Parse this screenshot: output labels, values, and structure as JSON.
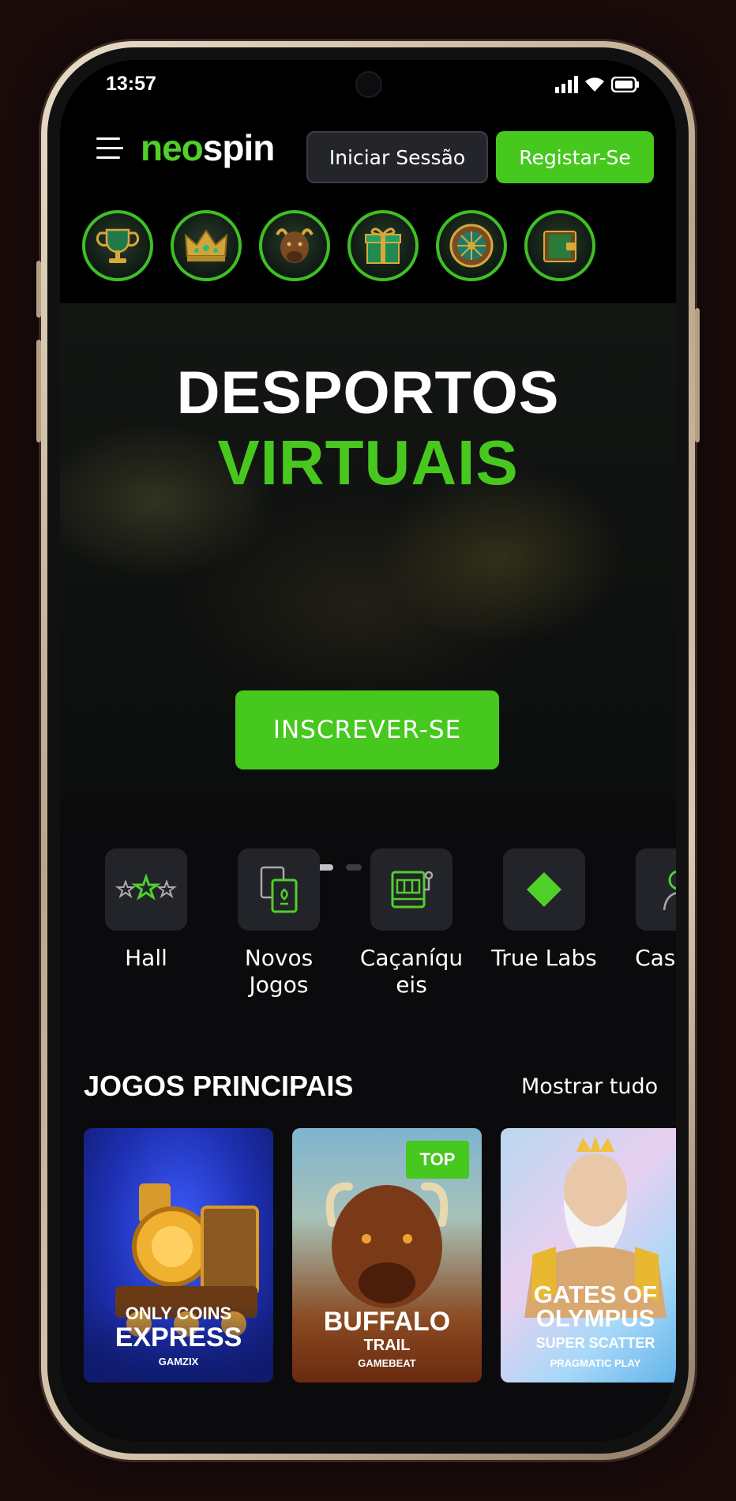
{
  "status_bar": {
    "time": "13:57"
  },
  "header": {
    "logo_part1": "neo",
    "logo_part2": "spin",
    "login_label": "Iniciar Sessão",
    "register_label": "Registar-Se"
  },
  "promos": [
    {
      "icon": "trophy-icon"
    },
    {
      "icon": "crown-icon"
    },
    {
      "icon": "bison-icon"
    },
    {
      "icon": "gift-icon"
    },
    {
      "icon": "wheel-icon"
    },
    {
      "icon": "book-icon"
    }
  ],
  "hero": {
    "title_line1": "DESPORTOS",
    "title_line2": "VIRTUAIS",
    "cta_label": "INSCREVER-SE",
    "slide_count": 6,
    "active_slide": 2
  },
  "categories": [
    {
      "label": "Hall",
      "icon": "stars-icon"
    },
    {
      "label": "Novos Jogos",
      "icon": "cards-icon"
    },
    {
      "label": "Caçaníqu eis",
      "icon": "slot-machine-icon"
    },
    {
      "label": "True Labs",
      "icon": "diamond-icon"
    },
    {
      "label": "Casir Vi",
      "icon": "live-dealer-icon"
    }
  ],
  "games_section": {
    "title": "JOGOS PRINCIPAIS",
    "show_all": "Mostrar tudo",
    "games": [
      {
        "line1": "ONLY COINS",
        "line2": "EXPRESS",
        "provider": "GAMZIX",
        "badge": ""
      },
      {
        "line1": "BUFFALO",
        "line2": "TRAIL",
        "provider": "GAMEBEAT",
        "badge": "TOP"
      },
      {
        "line1": "GATES OF",
        "line2": "OLYMPUS",
        "line3": "SUPER SCATTER",
        "provider": "PRAGMATIC PLAY",
        "badge": ""
      }
    ]
  },
  "colors": {
    "accent": "#46c81e",
    "background": "#0b0b0d",
    "button_dark": "#23252b"
  }
}
